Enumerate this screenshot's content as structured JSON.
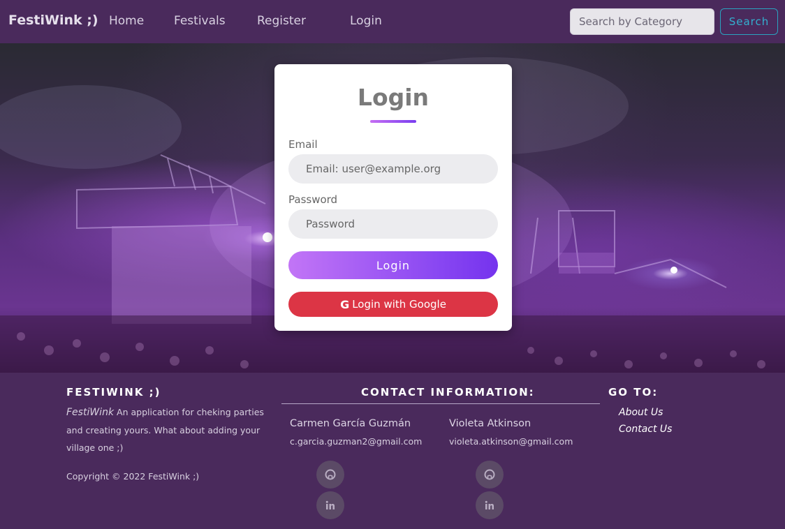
{
  "navbar": {
    "brand": "FestiWink ;)",
    "links": [
      "Home",
      "Festivals",
      "Register",
      "Login"
    ],
    "search_placeholder": "Search by Category",
    "search_button": "Search"
  },
  "login": {
    "title": "Login",
    "email_label": "Email",
    "email_placeholder": "Email: user@example.org",
    "password_label": "Password",
    "password_placeholder": "Password",
    "login_button": "Login",
    "google_button": "Login with Google",
    "google_icon_glyph": "G"
  },
  "footer": {
    "brand_heading": "FESTIWINK ;)",
    "brand_name": "FestiWink",
    "description": "An application for cheking parties and creating yours. What about adding your village one ;)",
    "copyright": "Copyright © 2022 FestiWink ;)",
    "contact_heading": "CONTACT INFORMATION:",
    "contacts": [
      {
        "name": "Carmen García Guzmán",
        "email": "c.garcia.guzman2@gmail.com"
      },
      {
        "name": "Violeta Atkinson",
        "email": "violeta.atkinson@gmail.com"
      }
    ],
    "goto_heading": "GO TO:",
    "goto_links": [
      "About Us",
      "Contact Us"
    ]
  },
  "colors": {
    "navbar_bg": "#4a2a5c",
    "accent_gradient_start": "#c275f6",
    "accent_gradient_end": "#7533ee",
    "google_red": "#dc3545",
    "search_accent": "#2aa3c0"
  },
  "icons": {
    "social": [
      "github-icon",
      "linkedin-icon"
    ]
  }
}
